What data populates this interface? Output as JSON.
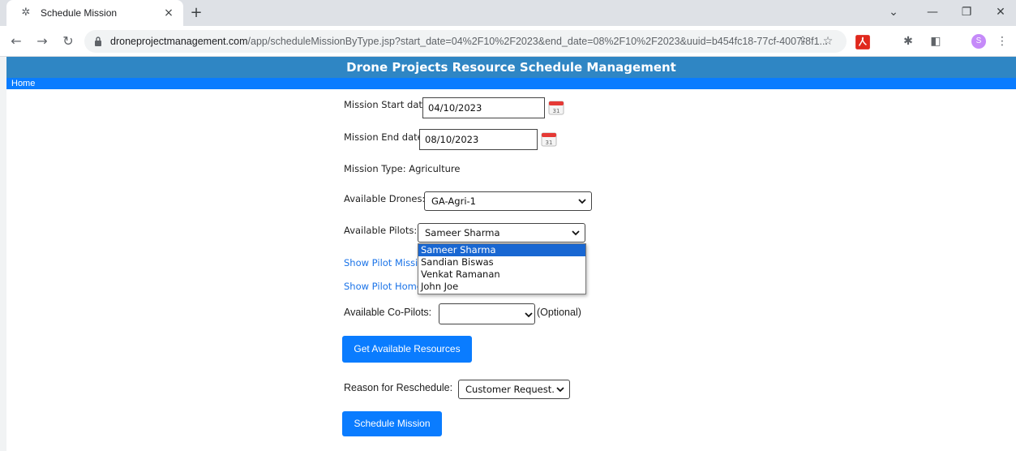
{
  "browser": {
    "tab_title": "Schedule Mission",
    "tab_close": "×",
    "new_tab": "+",
    "url_host": "droneprojectmanagement.com",
    "url_path": "/app/scheduleMissionByType.jsp?start_date=04%2F10%2F2023&end_date=08%2F10%2F2023&uuid=b454fc18-77cf-4007-8f1...",
    "profile_initial": "S"
  },
  "header": {
    "title": "Drone Projects Resource Schedule Management",
    "home_link": "Home"
  },
  "form": {
    "start_label": "Mission Start date:",
    "start_value": "04/10/2023",
    "end_label": "Mission End date:",
    "end_value": "08/10/2023",
    "mission_type_text": "Mission Type: Agriculture",
    "drones_label": "Available Drones:",
    "drones_value": "GA-Agri-1",
    "pilots_label": "Available Pilots:",
    "pilots_value": "Sameer Sharma",
    "pilot_options": [
      "Sameer Sharma",
      "Sandian Biswas",
      "Venkat Ramanan",
      "John Joe"
    ],
    "show_pilot_missions": "Show Pilot Missio",
    "show_pilot_home": "Show Pilot Home",
    "copilots_label": "Available Co-Pilots:",
    "copilots_value": "",
    "optional_text": "(Optional)",
    "get_resources_button": "Get Available Resources",
    "reason_label": "Reason for Reschedule:",
    "reason_value": "Customer Request.",
    "schedule_button": "Schedule Mission",
    "calendar_day": "31"
  },
  "colors": {
    "banner": "#2f86c4",
    "menubar": "#0a7cff",
    "button": "#0a7cff",
    "link": "#1a73e8",
    "selected_option": "#1967d2"
  }
}
